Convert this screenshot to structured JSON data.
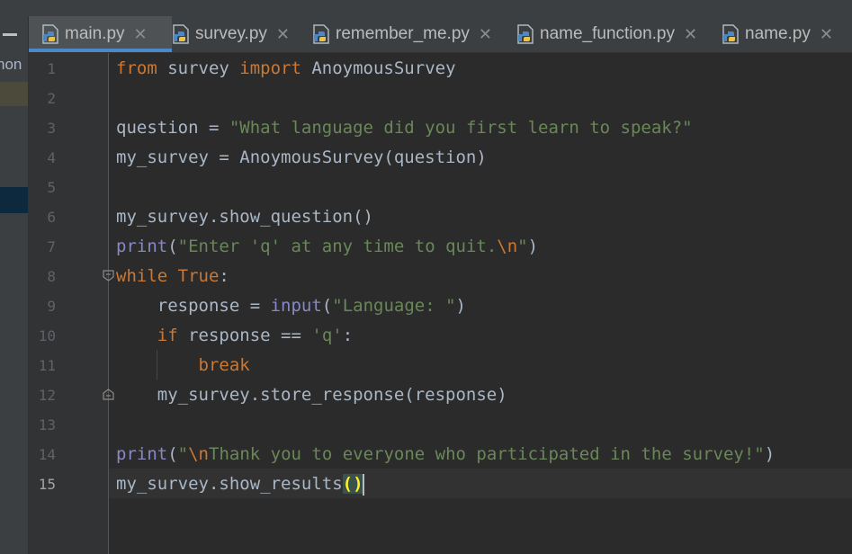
{
  "tabs": [
    {
      "label": "main.py",
      "active": true
    },
    {
      "label": "survey.py",
      "active": false
    },
    {
      "label": "remember_me.py",
      "active": false
    },
    {
      "label": "name_function.py",
      "active": false
    },
    {
      "label": "name.py",
      "active": false
    }
  ],
  "left_panel": {
    "partial_label": "hon"
  },
  "current_line": 15,
  "code_lines": [
    [
      [
        "kw",
        "from"
      ],
      [
        "t",
        " survey "
      ],
      [
        "kw",
        "import"
      ],
      [
        "t",
        " AnoymousSurvey"
      ]
    ],
    [],
    [
      [
        "t",
        "question = "
      ],
      [
        "str",
        "\"What language did you first learn to speak?\""
      ]
    ],
    [
      [
        "t",
        "my_survey = AnoymousSurvey(question)"
      ]
    ],
    [],
    [
      [
        "t",
        "my_survey.show_question()"
      ]
    ],
    [
      [
        "bi",
        "print"
      ],
      [
        "t",
        "("
      ],
      [
        "str",
        "\"Enter 'q' at any time to quit."
      ],
      [
        "esc",
        "\\n"
      ],
      [
        "str",
        "\""
      ],
      [
        "t",
        ")"
      ]
    ],
    [
      [
        "kw",
        "while"
      ],
      [
        "t",
        " "
      ],
      [
        "kw",
        "True"
      ],
      [
        "t",
        ":"
      ]
    ],
    [
      [
        "t",
        "    response = "
      ],
      [
        "bi",
        "input"
      ],
      [
        "t",
        "("
      ],
      [
        "str",
        "\"Language: \""
      ],
      [
        "t",
        ")"
      ]
    ],
    [
      [
        "t",
        "    "
      ],
      [
        "kw",
        "if"
      ],
      [
        "t",
        " response == "
      ],
      [
        "str",
        "'q'"
      ],
      [
        "t",
        ":"
      ]
    ],
    [
      [
        "t",
        "        "
      ],
      [
        "kw",
        "break"
      ]
    ],
    [
      [
        "t",
        "    my_survey.store_response(response)"
      ]
    ],
    [],
    [
      [
        "bi",
        "print"
      ],
      [
        "t",
        "("
      ],
      [
        "str",
        "\""
      ],
      [
        "esc",
        "\\n"
      ],
      [
        "str",
        "Thank you to everyone who participated in the survey!\""
      ],
      [
        "t",
        ")"
      ]
    ],
    [
      [
        "t",
        "my_survey.show_results"
      ],
      [
        "hl",
        "()"
      ]
    ]
  ],
  "icons": {
    "file": "python-file-icon",
    "close": "close-icon",
    "fold": "fold-marker-icon"
  },
  "colors": {
    "keyword": "#cc7832",
    "string": "#6a8759",
    "builtin": "#8888c6",
    "text": "#a9b7c6",
    "tab_underline": "#4a88c7"
  }
}
